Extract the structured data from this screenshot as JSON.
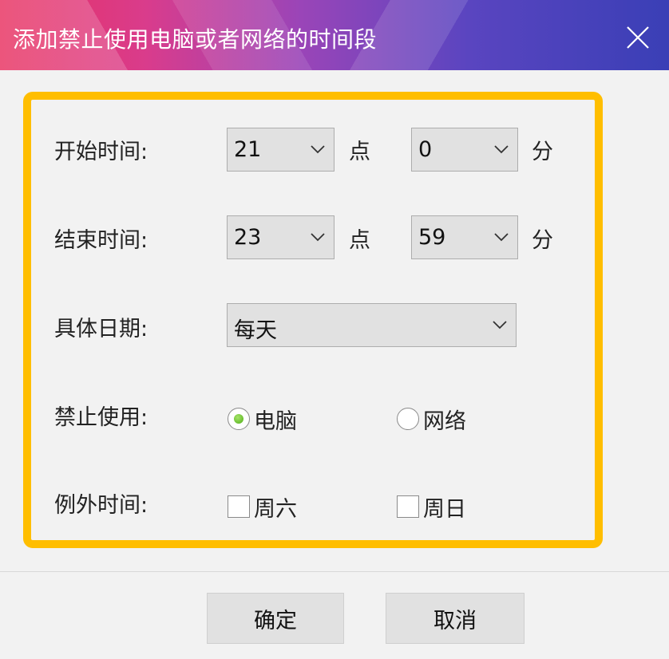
{
  "window": {
    "title": "添加禁止使用电脑或者网络的时间段"
  },
  "icons": {
    "close": "close-icon",
    "dropdown": "chevron-down-icon"
  },
  "colors": {
    "frame_highlight": "#ffbe00",
    "radio_selected": "#4fae16"
  },
  "form": {
    "start_time": {
      "label": "开始时间:",
      "hour": "21",
      "hour_unit": "点",
      "minute": "0",
      "minute_unit": "分"
    },
    "end_time": {
      "label": "结束时间:",
      "hour": "23",
      "hour_unit": "点",
      "minute": "59",
      "minute_unit": "分"
    },
    "date": {
      "label": "具体日期:",
      "value": "每天"
    },
    "block": {
      "label": "禁止使用:",
      "options": [
        {
          "label": "电脑",
          "selected": true
        },
        {
          "label": "网络",
          "selected": false
        }
      ]
    },
    "exception": {
      "label": "例外时间:",
      "options": [
        {
          "label": "周六",
          "checked": false
        },
        {
          "label": "周日",
          "checked": false
        }
      ]
    }
  },
  "buttons": {
    "ok": "确定",
    "cancel": "取消"
  }
}
